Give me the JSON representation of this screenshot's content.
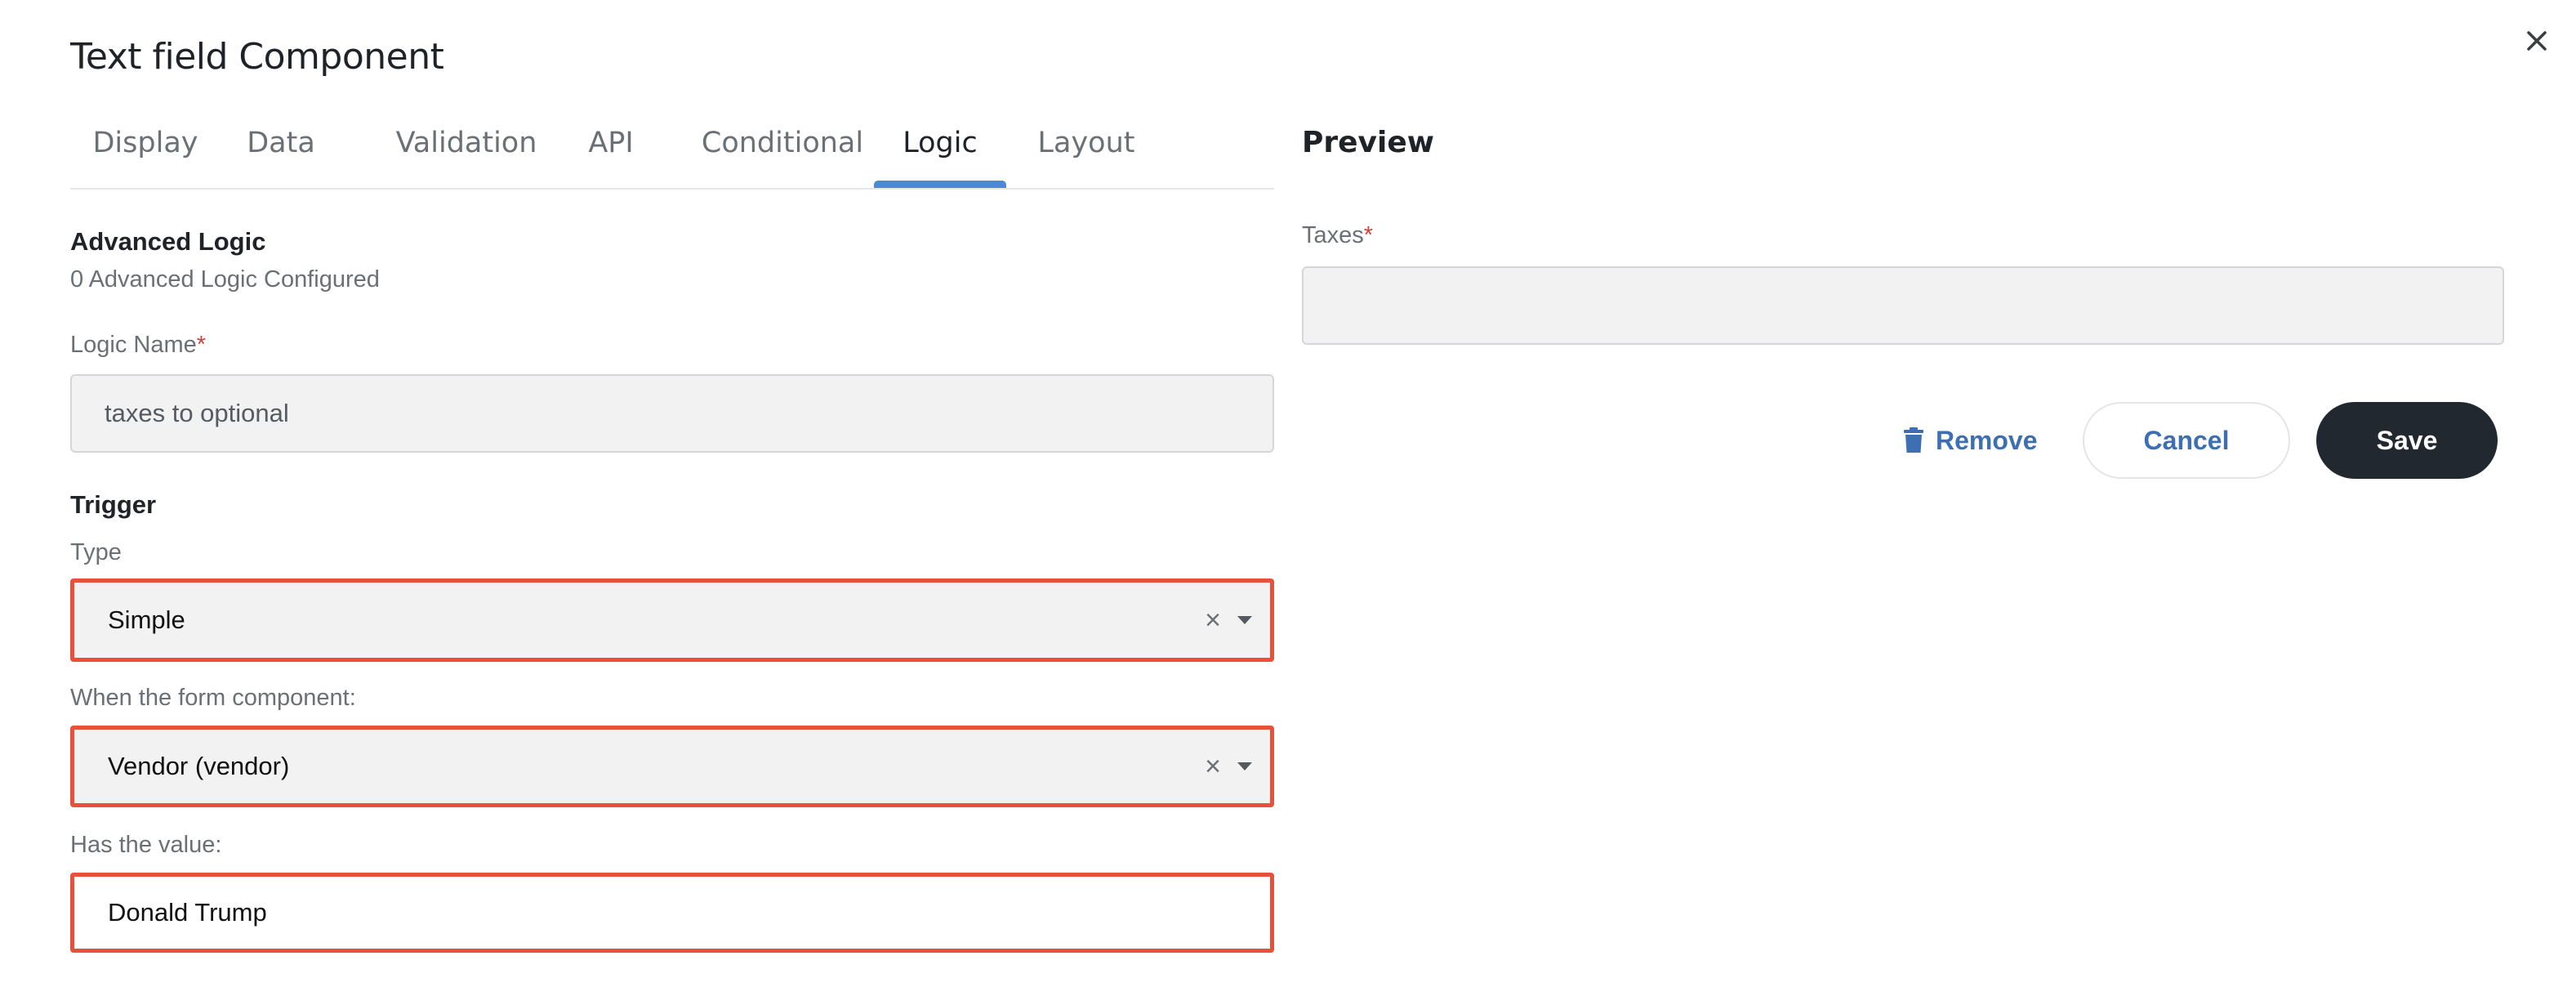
{
  "dialog": {
    "title": "Text field Component",
    "close_icon": "close-icon"
  },
  "tabs": [
    {
      "label": "Display",
      "active": false
    },
    {
      "label": "Data",
      "active": false
    },
    {
      "label": "Validation",
      "active": false
    },
    {
      "label": "API",
      "active": false
    },
    {
      "label": "Conditional",
      "active": false
    },
    {
      "label": "Logic",
      "active": true
    },
    {
      "label": "Layout",
      "active": false
    }
  ],
  "advanced_logic": {
    "heading": "Advanced Logic",
    "summary": "0 Advanced Logic Configured"
  },
  "logic_name": {
    "label": "Logic Name",
    "required_mark": "*",
    "value": "taxes to optional"
  },
  "trigger": {
    "heading": "Trigger",
    "type_label": "Type",
    "type_value": "Simple",
    "component_label": "When the form component:",
    "component_value": "Vendor (vendor)",
    "value_label": "Has the value:",
    "value_value": "Donald Trump"
  },
  "preview": {
    "title": "Preview",
    "field_label": "Taxes",
    "required_mark": "*",
    "field_value": ""
  },
  "actions": {
    "remove_label": "Remove",
    "cancel_label": "Cancel",
    "save_label": "Save"
  },
  "colors": {
    "accent": "#4f86d9",
    "link": "#3e6fb3",
    "highlight_border": "#e8503a",
    "save_bg": "#22282f",
    "required": "#d93b3b"
  }
}
